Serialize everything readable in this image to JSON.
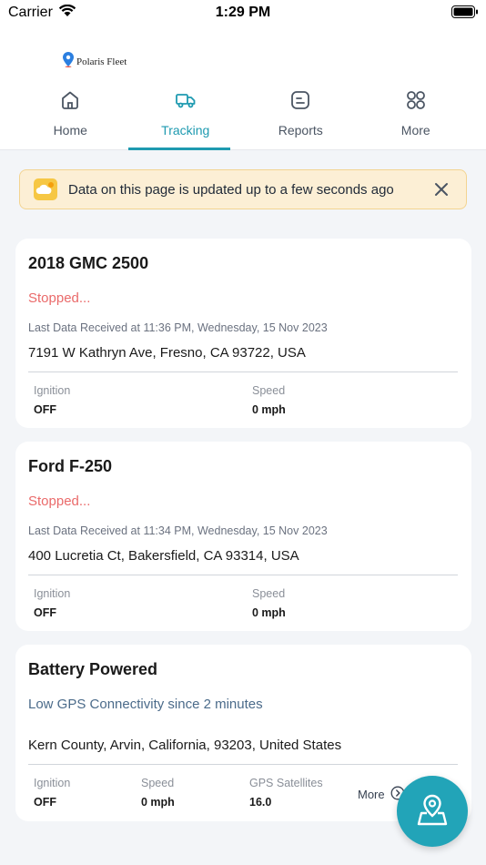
{
  "status_bar": {
    "carrier": "Carrier",
    "time": "1:29 PM"
  },
  "header": {
    "brand": "Polaris Fleet",
    "tabs": [
      {
        "label": "Home",
        "icon": "home-icon",
        "active": false
      },
      {
        "label": "Tracking",
        "icon": "truck-icon",
        "active": true
      },
      {
        "label": "Reports",
        "icon": "reports-icon",
        "active": false
      },
      {
        "label": "More",
        "icon": "grid-icon",
        "active": false
      }
    ]
  },
  "banner": {
    "text": "Data on this page is updated up to a few seconds ago",
    "icon": "cloud-sun-icon"
  },
  "vehicles": [
    {
      "name": "2018 GMC 2500",
      "status": "Stopped...",
      "last_data": "Last Data Received at 11:36 PM, Wednesday, 15 Nov 2023",
      "address": "7191 W Kathryn Ave, Fresno, CA 93722, USA",
      "ignition_label": "Ignition",
      "ignition_value": "OFF",
      "speed_label": "Speed",
      "speed_value": "0 mph"
    },
    {
      "name": "Ford F-250",
      "status": "Stopped...",
      "last_data": "Last Data Received at 11:34 PM, Wednesday, 15 Nov 2023",
      "address": "400 Lucretia Ct, Bakersfield, CA 93314, USA",
      "ignition_label": "Ignition",
      "ignition_value": "OFF",
      "speed_label": "Speed",
      "speed_value": "0 mph"
    },
    {
      "name": "Battery Powered",
      "status": "Low GPS Connectivity since 2 minutes",
      "address": "Kern County, Arvin, California, 93203, United States",
      "ignition_label": "Ignition",
      "ignition_value": "OFF",
      "speed_label": "Speed",
      "speed_value": "0 mph",
      "gps_label": "GPS Satellites",
      "gps_value": "16.0",
      "more_label": "More"
    }
  ],
  "fab": {
    "icon": "map-pin-icon"
  },
  "colors": {
    "accent": "#1e9ab0",
    "stopped": "#ea6a6a",
    "banner_bg": "#fcefd5",
    "fab": "#22a4b8"
  }
}
